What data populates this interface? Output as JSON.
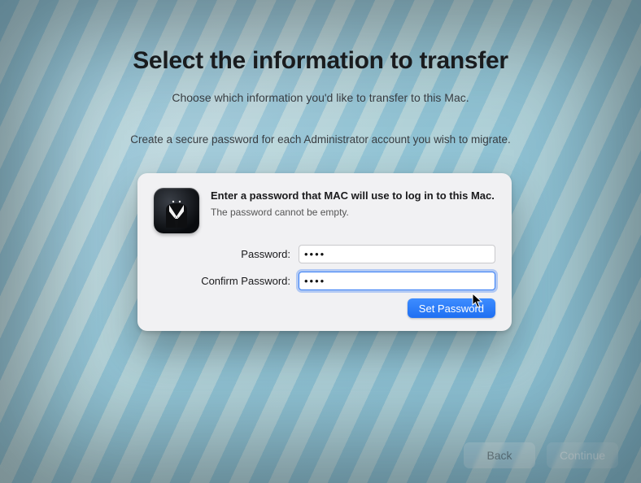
{
  "page": {
    "title": "Select the information to transfer",
    "subtitle": "Choose which information you'd like to transfer to this Mac.",
    "instruction": "Create a secure password for each Administrator account you wish to migrate."
  },
  "dialog": {
    "heading": "Enter a password that MAC will use to log in to this Mac.",
    "sub": "The password cannot be empty.",
    "password_label": "Password:",
    "confirm_label": "Confirm Password:",
    "password_value": "••••",
    "confirm_value": "••••",
    "set_button": "Set Password"
  },
  "footer": {
    "back": "Back",
    "continue": "Continue"
  },
  "colors": {
    "accent": "#2f7ff6"
  }
}
